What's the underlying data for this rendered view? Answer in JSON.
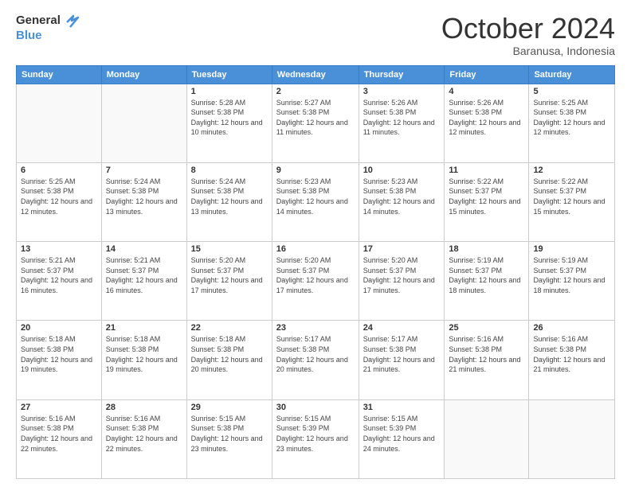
{
  "header": {
    "logo_general": "General",
    "logo_blue": "Blue",
    "month_title": "October 2024",
    "location": "Baranusa, Indonesia"
  },
  "weekdays": [
    "Sunday",
    "Monday",
    "Tuesday",
    "Wednesday",
    "Thursday",
    "Friday",
    "Saturday"
  ],
  "weeks": [
    [
      {
        "day": "",
        "info": ""
      },
      {
        "day": "",
        "info": ""
      },
      {
        "day": "1",
        "info": "Sunrise: 5:28 AM\nSunset: 5:38 PM\nDaylight: 12 hours and 10 minutes."
      },
      {
        "day": "2",
        "info": "Sunrise: 5:27 AM\nSunset: 5:38 PM\nDaylight: 12 hours and 11 minutes."
      },
      {
        "day": "3",
        "info": "Sunrise: 5:26 AM\nSunset: 5:38 PM\nDaylight: 12 hours and 11 minutes."
      },
      {
        "day": "4",
        "info": "Sunrise: 5:26 AM\nSunset: 5:38 PM\nDaylight: 12 hours and 12 minutes."
      },
      {
        "day": "5",
        "info": "Sunrise: 5:25 AM\nSunset: 5:38 PM\nDaylight: 12 hours and 12 minutes."
      }
    ],
    [
      {
        "day": "6",
        "info": "Sunrise: 5:25 AM\nSunset: 5:38 PM\nDaylight: 12 hours and 12 minutes."
      },
      {
        "day": "7",
        "info": "Sunrise: 5:24 AM\nSunset: 5:38 PM\nDaylight: 12 hours and 13 minutes."
      },
      {
        "day": "8",
        "info": "Sunrise: 5:24 AM\nSunset: 5:38 PM\nDaylight: 12 hours and 13 minutes."
      },
      {
        "day": "9",
        "info": "Sunrise: 5:23 AM\nSunset: 5:38 PM\nDaylight: 12 hours and 14 minutes."
      },
      {
        "day": "10",
        "info": "Sunrise: 5:23 AM\nSunset: 5:38 PM\nDaylight: 12 hours and 14 minutes."
      },
      {
        "day": "11",
        "info": "Sunrise: 5:22 AM\nSunset: 5:37 PM\nDaylight: 12 hours and 15 minutes."
      },
      {
        "day": "12",
        "info": "Sunrise: 5:22 AM\nSunset: 5:37 PM\nDaylight: 12 hours and 15 minutes."
      }
    ],
    [
      {
        "day": "13",
        "info": "Sunrise: 5:21 AM\nSunset: 5:37 PM\nDaylight: 12 hours and 16 minutes."
      },
      {
        "day": "14",
        "info": "Sunrise: 5:21 AM\nSunset: 5:37 PM\nDaylight: 12 hours and 16 minutes."
      },
      {
        "day": "15",
        "info": "Sunrise: 5:20 AM\nSunset: 5:37 PM\nDaylight: 12 hours and 17 minutes."
      },
      {
        "day": "16",
        "info": "Sunrise: 5:20 AM\nSunset: 5:37 PM\nDaylight: 12 hours and 17 minutes."
      },
      {
        "day": "17",
        "info": "Sunrise: 5:20 AM\nSunset: 5:37 PM\nDaylight: 12 hours and 17 minutes."
      },
      {
        "day": "18",
        "info": "Sunrise: 5:19 AM\nSunset: 5:37 PM\nDaylight: 12 hours and 18 minutes."
      },
      {
        "day": "19",
        "info": "Sunrise: 5:19 AM\nSunset: 5:37 PM\nDaylight: 12 hours and 18 minutes."
      }
    ],
    [
      {
        "day": "20",
        "info": "Sunrise: 5:18 AM\nSunset: 5:38 PM\nDaylight: 12 hours and 19 minutes."
      },
      {
        "day": "21",
        "info": "Sunrise: 5:18 AM\nSunset: 5:38 PM\nDaylight: 12 hours and 19 minutes."
      },
      {
        "day": "22",
        "info": "Sunrise: 5:18 AM\nSunset: 5:38 PM\nDaylight: 12 hours and 20 minutes."
      },
      {
        "day": "23",
        "info": "Sunrise: 5:17 AM\nSunset: 5:38 PM\nDaylight: 12 hours and 20 minutes."
      },
      {
        "day": "24",
        "info": "Sunrise: 5:17 AM\nSunset: 5:38 PM\nDaylight: 12 hours and 21 minutes."
      },
      {
        "day": "25",
        "info": "Sunrise: 5:16 AM\nSunset: 5:38 PM\nDaylight: 12 hours and 21 minutes."
      },
      {
        "day": "26",
        "info": "Sunrise: 5:16 AM\nSunset: 5:38 PM\nDaylight: 12 hours and 21 minutes."
      }
    ],
    [
      {
        "day": "27",
        "info": "Sunrise: 5:16 AM\nSunset: 5:38 PM\nDaylight: 12 hours and 22 minutes."
      },
      {
        "day": "28",
        "info": "Sunrise: 5:16 AM\nSunset: 5:38 PM\nDaylight: 12 hours and 22 minutes."
      },
      {
        "day": "29",
        "info": "Sunrise: 5:15 AM\nSunset: 5:38 PM\nDaylight: 12 hours and 23 minutes."
      },
      {
        "day": "30",
        "info": "Sunrise: 5:15 AM\nSunset: 5:39 PM\nDaylight: 12 hours and 23 minutes."
      },
      {
        "day": "31",
        "info": "Sunrise: 5:15 AM\nSunset: 5:39 PM\nDaylight: 12 hours and 24 minutes."
      },
      {
        "day": "",
        "info": ""
      },
      {
        "day": "",
        "info": ""
      }
    ]
  ]
}
